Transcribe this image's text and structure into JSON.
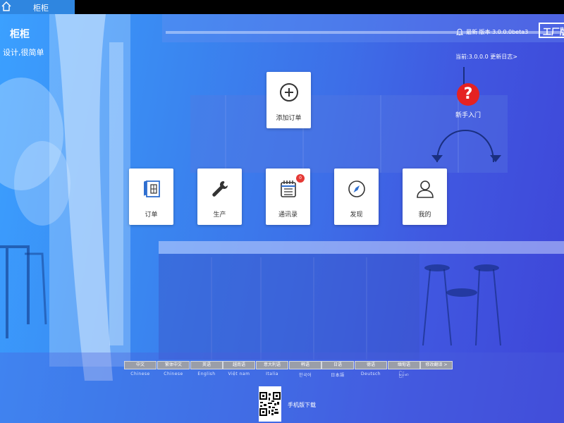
{
  "header": {
    "title": "柜柜"
  },
  "brand": {
    "name": "柜柜",
    "slogan": "设计,很简单"
  },
  "version": {
    "latest": "最新 版本 3.0.0.0beta3",
    "current": "当前:3.0.0.0 更新日志>",
    "edition": "工厂版"
  },
  "guide": {
    "symbol": "?",
    "label": "新手入门"
  },
  "cards": {
    "add_order": "添加订单",
    "orders": "订单",
    "production": "生产",
    "contacts": "通讯录",
    "contacts_badge": "0",
    "discover": "发现",
    "mine": "我的"
  },
  "languages": [
    {
      "label": "中文",
      "sub": "Chinese"
    },
    {
      "label": "繁体中文",
      "sub": "Chinese"
    },
    {
      "label": "英语",
      "sub": "English"
    },
    {
      "label": "越南语",
      "sub": "Việt nam"
    },
    {
      "label": "意大利语",
      "sub": "Italia"
    },
    {
      "label": "韩语",
      "sub": "한국어"
    },
    {
      "label": "日语",
      "sub": "日本語"
    },
    {
      "label": "德语",
      "sub": "Deutsch"
    },
    {
      "label": "缅甸语",
      "sub": "မြန်မာ"
    }
  ],
  "lang_more": "修改翻译 >",
  "download": {
    "label": "手机版下载"
  },
  "colors": {
    "accent": "#2f86e0",
    "guide_red": "#e52222",
    "badge_red": "#e53935"
  }
}
